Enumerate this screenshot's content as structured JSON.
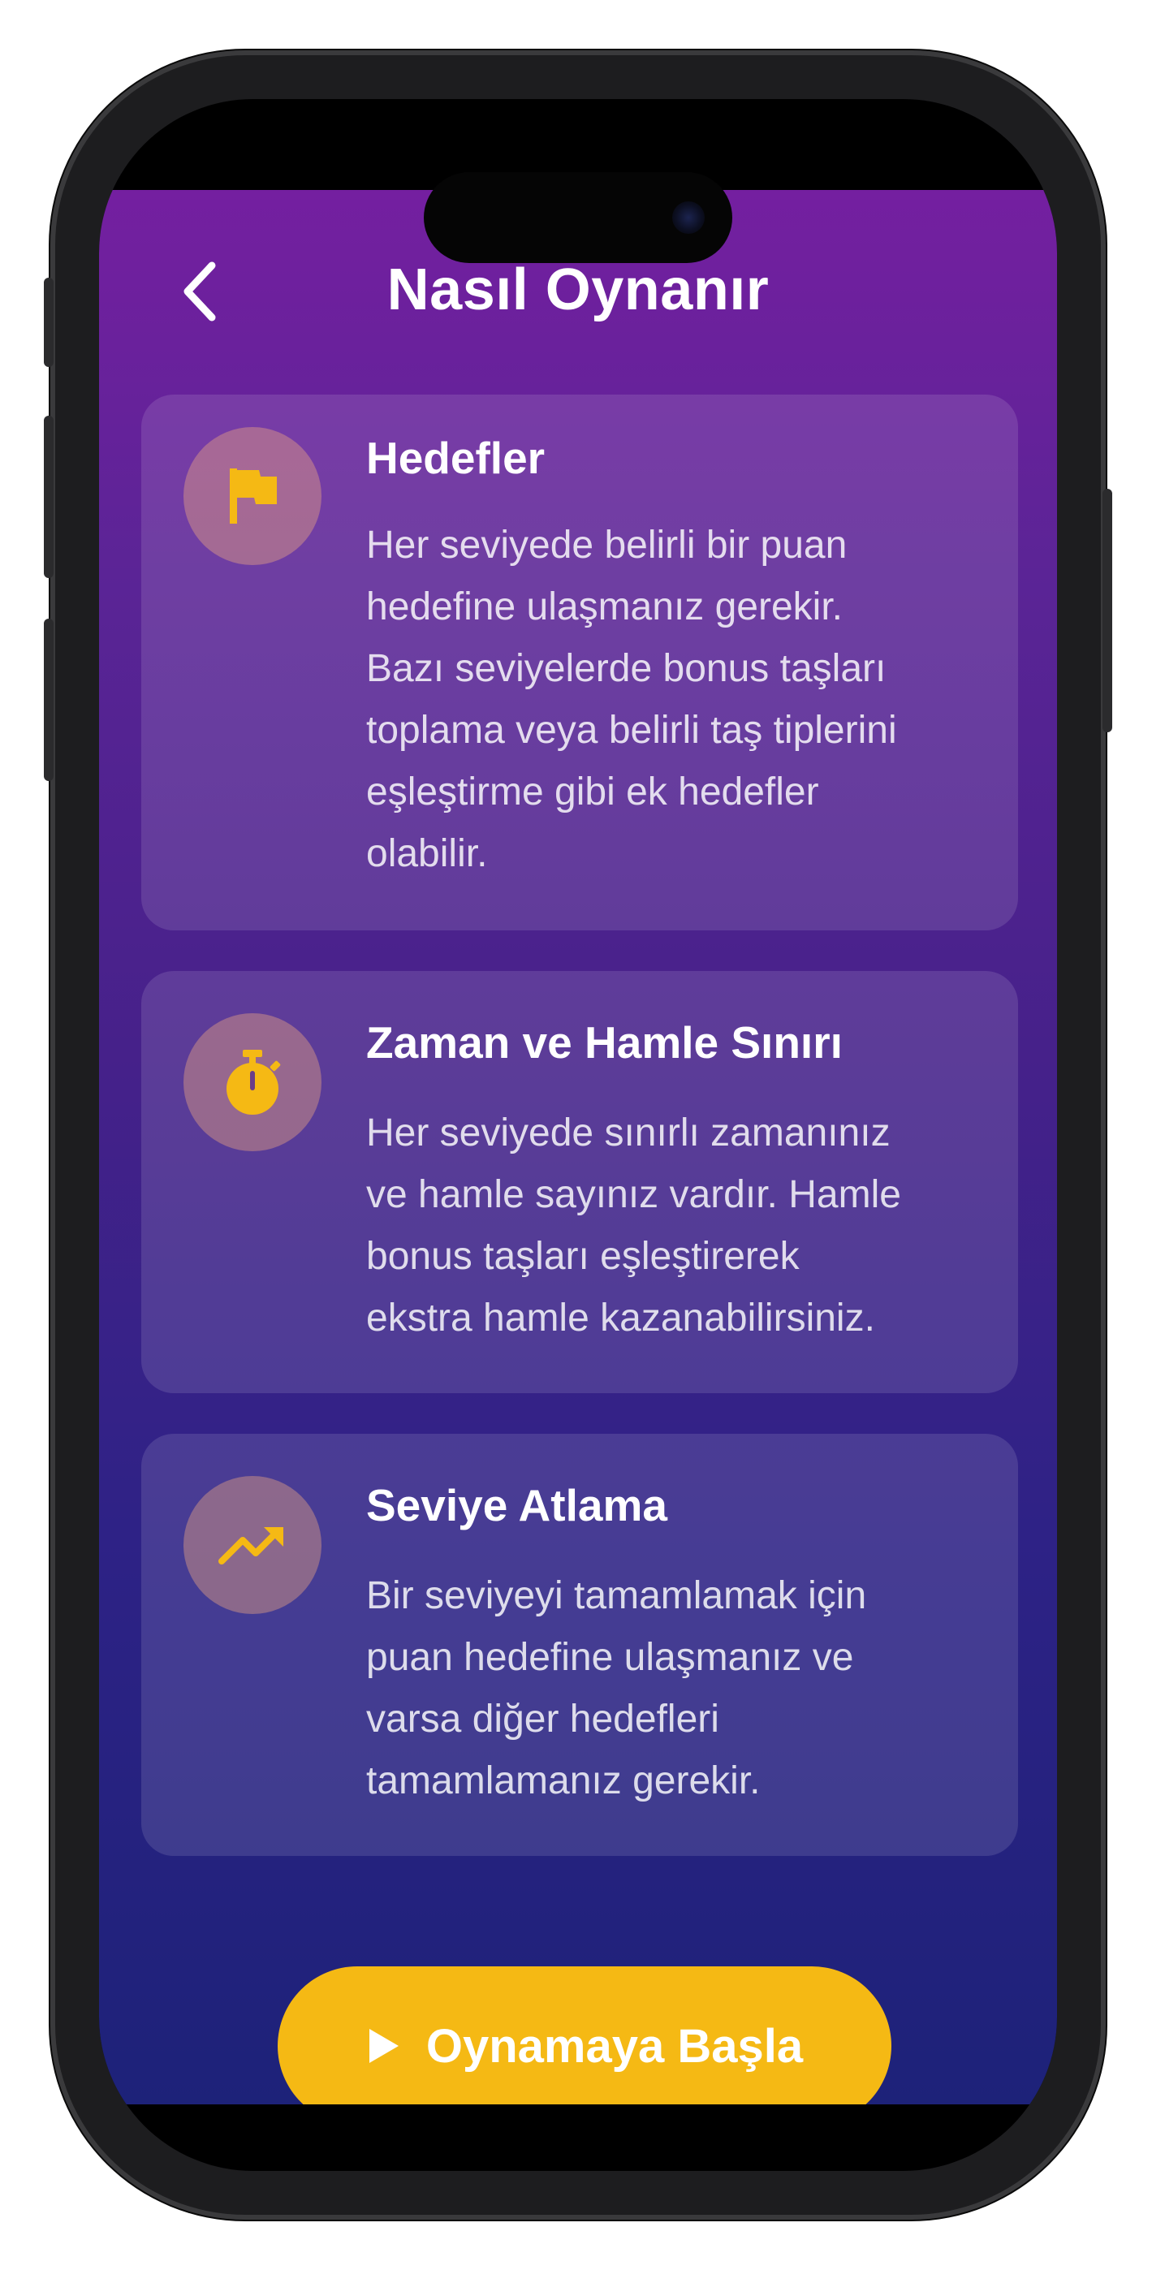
{
  "header": {
    "title": "Nasıl Oynanır",
    "back_icon": "chevron-left-icon"
  },
  "cards": [
    {
      "icon": "flag-icon",
      "title": "Hedefler",
      "lines": [
        "Her seviyede belirli bir puan",
        "hedefine ulaşmanız gerekir.",
        "Bazı seviyelerde bonus taşları",
        "toplama veya belirli taş tiplerini",
        "eşleştirme gibi ek hedefler",
        "olabilir."
      ]
    },
    {
      "icon": "timer-icon",
      "title": "Zaman ve Hamle Sınırı",
      "lines": [
        "Her seviyede sınırlı zamanınız",
        "ve hamle sayınız vardır. Hamle",
        "bonus taşları eşleştirerek",
        "ekstra hamle kazanabilirsiniz."
      ]
    },
    {
      "icon": "trending-up-icon",
      "title": "Seviye Atlama",
      "lines": [
        "Bir seviyeyi tamamlamak için",
        "puan hedefine ulaşmanız ve",
        "varsa diğer hedefleri",
        "tamamlamanız gerekir."
      ]
    }
  ],
  "play_button": {
    "label": "Oynamaya Başla",
    "icon": "play-icon"
  },
  "colors": {
    "accent": "#f5b914",
    "gradient_top": "#741fa0",
    "gradient_bottom": "#1d2279"
  }
}
